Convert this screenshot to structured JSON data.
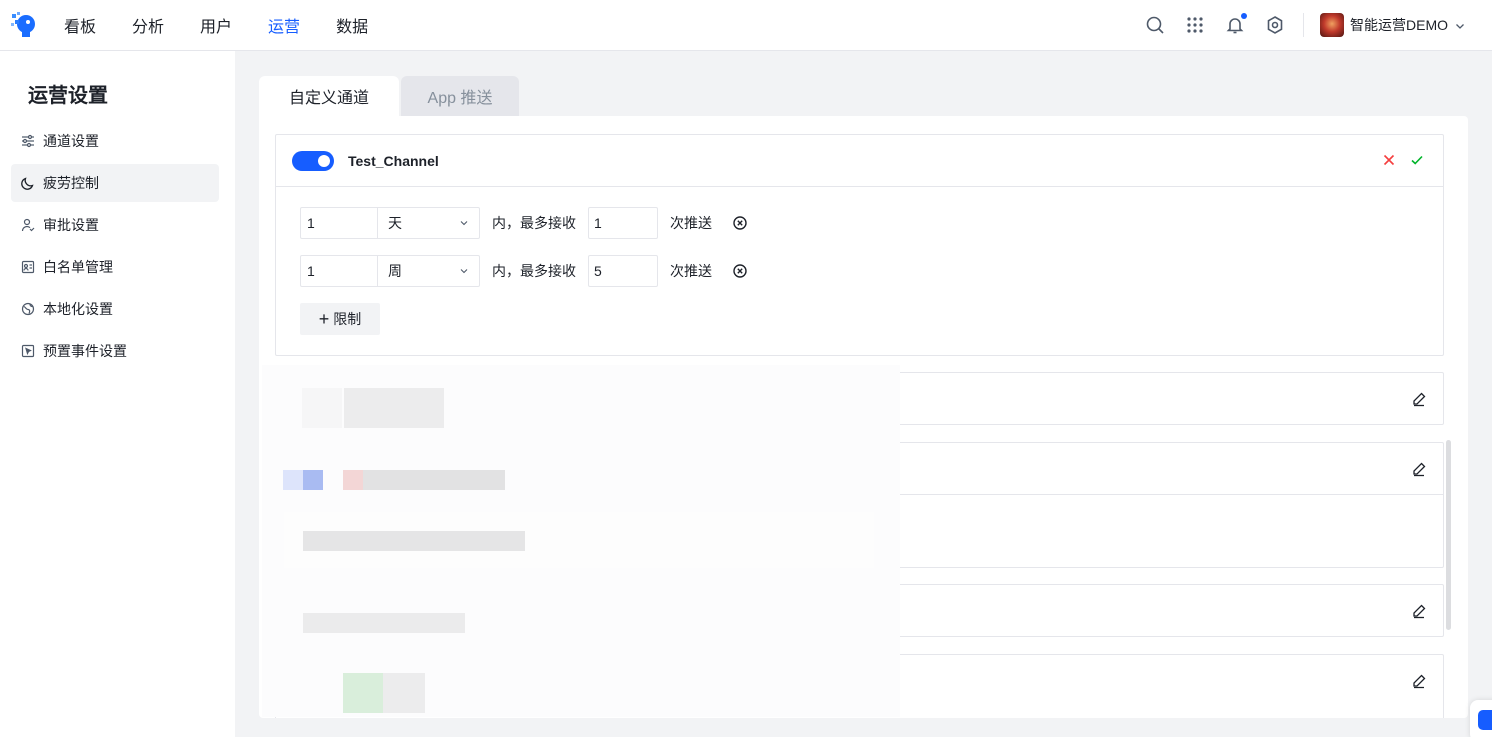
{
  "header": {
    "nav": [
      "看板",
      "分析",
      "用户",
      "运营",
      "数据"
    ],
    "active_nav": "运营",
    "user_name": "智能运营DEMO",
    "icons": [
      "search-icon",
      "apps-grid-icon",
      "bell-icon",
      "settings-icon"
    ]
  },
  "sidebar": {
    "title": "运营设置",
    "items": [
      {
        "label": "通道设置",
        "icon": "sliders-icon"
      },
      {
        "label": "疲劳控制",
        "icon": "moon-icon"
      },
      {
        "label": "审批设置",
        "icon": "user-check-icon"
      },
      {
        "label": "白名单管理",
        "icon": "id-card-icon"
      },
      {
        "label": "本地化设置",
        "icon": "globe-icon"
      },
      {
        "label": "预置事件设置",
        "icon": "cursor-box-icon"
      }
    ],
    "active_item": "疲劳控制"
  },
  "tabs": [
    {
      "label": "自定义通道",
      "active": true
    },
    {
      "label": "App 推送",
      "active": false
    }
  ],
  "channel": {
    "name": "Test_Channel",
    "enabled": true,
    "rules": [
      {
        "period": "1",
        "unit": "天",
        "text": "内，最多接收",
        "count": "1",
        "suffix": "次推送"
      },
      {
        "period": "1",
        "unit": "周",
        "text": "内，最多接收",
        "count": "5",
        "suffix": "次推送"
      }
    ],
    "add_label": "限制"
  },
  "colors": {
    "primary": "#165dff",
    "cancel": "#f53f3f",
    "confirm": "#00b42a"
  }
}
